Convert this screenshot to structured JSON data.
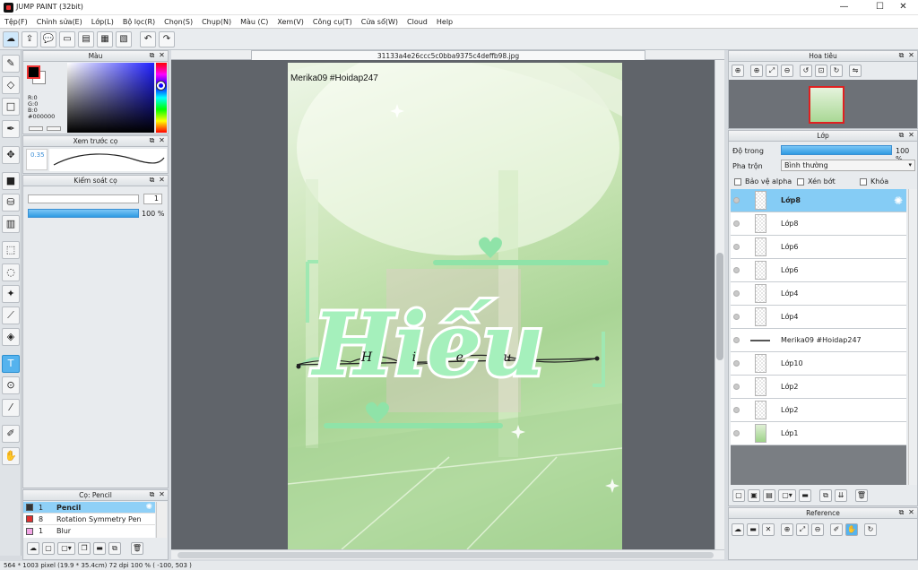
{
  "window": {
    "title": "JUMP PAINT (32bit)",
    "minimize": "—",
    "maximize": "☐",
    "close": "✕"
  },
  "menu": [
    "Tệp(F)",
    "Chỉnh sửa(E)",
    "Lớp(L)",
    "Bộ lọc(R)",
    "Chọn(S)",
    "Chụp(N)",
    "Màu (C)",
    "Xem(V)",
    "Công cụ(T)",
    "Cửa sổ(W)",
    "Cloud",
    "Help"
  ],
  "color_panel": {
    "title": "Màu",
    "fg_color": "#000000",
    "r": "R:0",
    "g": "G:0",
    "b": "B:0",
    "hex": "#000000"
  },
  "brush_preview": {
    "title": "Xem trước cọ",
    "size": "0.35"
  },
  "brush_control": {
    "title": "Kiểm soát cọ",
    "size_value": "1",
    "opacity_value": "100 %",
    "opacity_fraction": 1.0
  },
  "brush_list": {
    "title": "Cọ: Pencil",
    "items": [
      {
        "size": "1",
        "name": "Pencil",
        "color": "#333333",
        "selected": true
      },
      {
        "size": "8",
        "name": "Rotation Symmetry Pen",
        "color": "#e03030",
        "selected": false
      },
      {
        "size": "1",
        "name": "Blur",
        "color": "#f3a6e6",
        "selected": false
      }
    ]
  },
  "document": {
    "tab": "31133a4e26ccc5c0bba9375c4deffb98.jpg",
    "watermark": "Merika09 #Hoidap247",
    "big_text": "Hiếu",
    "script_text": "H i e u"
  },
  "navigator": {
    "title": "Hoa tiêu"
  },
  "layer_panel": {
    "title": "Lớp",
    "opacity_label": "Độ trong",
    "opacity_value": "100 %",
    "opacity_fraction": 1.0,
    "blend_label": "Pha trộn",
    "blend_value": "Bình thường",
    "protect_alpha": "Bảo vệ alpha",
    "clip": "Xén bớt",
    "lock": "Khóa",
    "layers": [
      "Lớp8",
      "Lớp8",
      "Lớp6",
      "Lớp6",
      "Lớp4",
      "Lớp4",
      "Merika09 #Hoidap247",
      "Lớp10",
      "Lớp2",
      "Lớp2",
      "Lớp1"
    ]
  },
  "reference": {
    "title": "Reference"
  },
  "status": "564 * 1003 pixel   (19.9 * 35.4cm)   72 dpi   100 %   ( -100, 503 )"
}
